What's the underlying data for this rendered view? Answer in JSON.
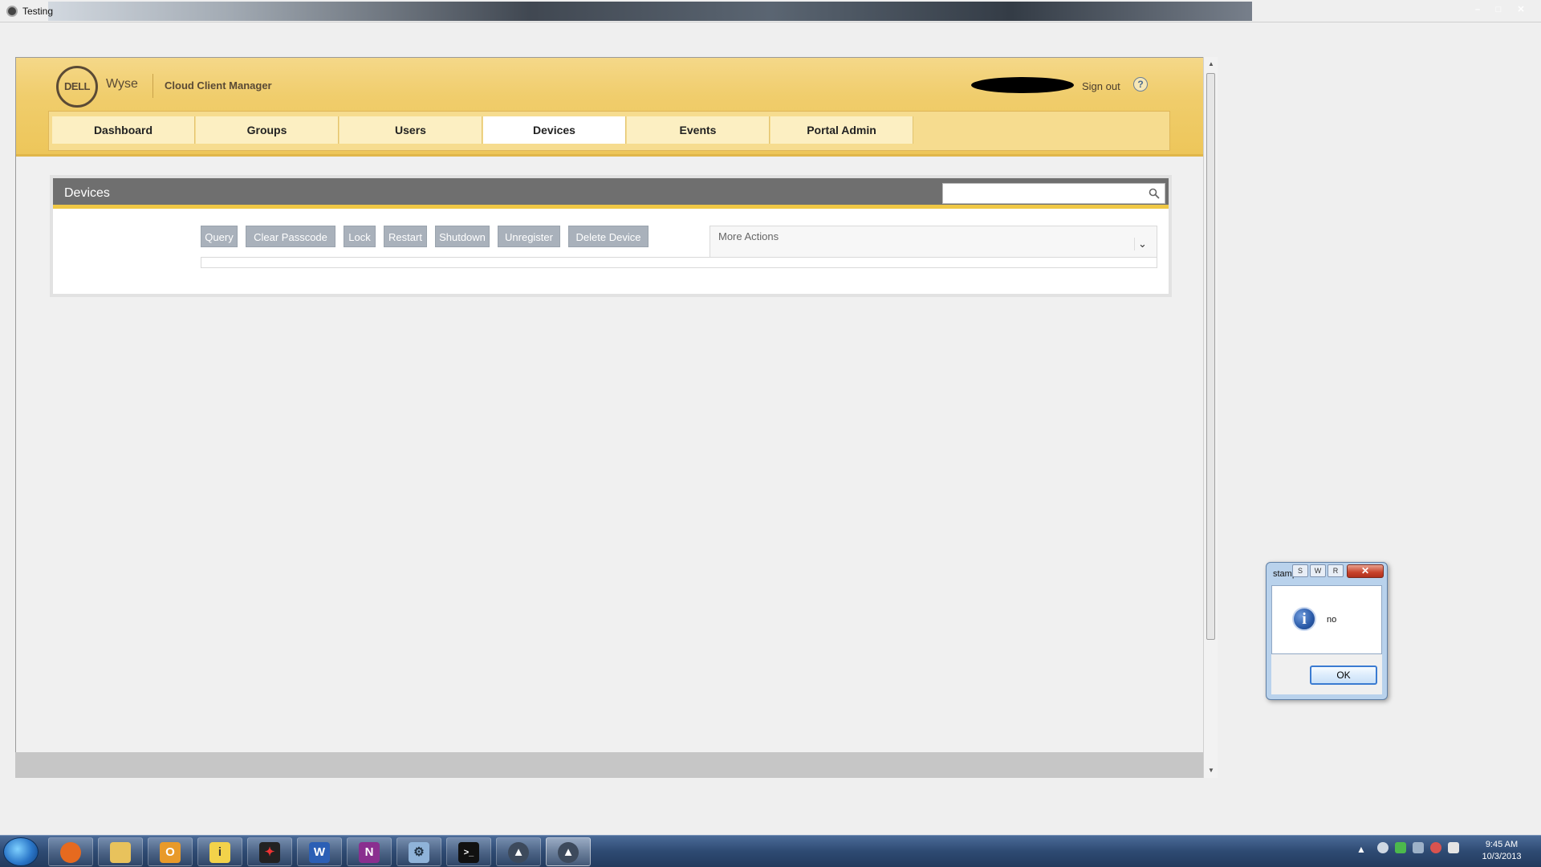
{
  "os_window": {
    "title": "Testing",
    "controls": [
      "–",
      "□",
      "✕"
    ]
  },
  "header": {
    "logo_text": "DELL",
    "brand": "Wyse",
    "product": "Cloud Client Manager",
    "signout_label": "Sign out",
    "help_label": "?"
  },
  "nav": {
    "tabs": [
      {
        "label": "Dashboard",
        "active": false
      },
      {
        "label": "Groups",
        "active": false
      },
      {
        "label": "Users",
        "active": false
      },
      {
        "label": "Devices",
        "active": true
      },
      {
        "label": "Events",
        "active": false
      },
      {
        "label": "Portal Admin",
        "active": false
      }
    ]
  },
  "devices_panel": {
    "title": "Devices",
    "search": {
      "value": "",
      "placeholder": ""
    },
    "actions": [
      "Query",
      "Clear Passcode",
      "Lock",
      "Restart",
      "Shutdown",
      "Unregister",
      "Delete Device"
    ],
    "more_actions_label": "More Actions"
  },
  "dialog": {
    "title": "stamp",
    "mini_buttons": [
      "S",
      "W",
      "R"
    ],
    "close_label": "✕",
    "message": "no",
    "ok_label": "OK"
  },
  "taskbar": {
    "apps": [
      {
        "icon": "firefox-icon",
        "glyph": "🦊"
      },
      {
        "icon": "folder-icon",
        "glyph": "📁"
      },
      {
        "icon": "outlook-icon",
        "glyph": "O"
      },
      {
        "icon": "app-icon",
        "glyph": "i"
      },
      {
        "icon": "puzzle-icon",
        "glyph": "✦"
      },
      {
        "icon": "word-icon",
        "glyph": "W"
      },
      {
        "icon": "onenote-icon",
        "glyph": "N"
      },
      {
        "icon": "network-icon",
        "glyph": "⚙"
      },
      {
        "icon": "terminal-icon",
        "glyph": ">_"
      },
      {
        "icon": "citrix-icon",
        "glyph": "▲"
      },
      {
        "icon": "citrix-active-icon",
        "glyph": "▲"
      }
    ],
    "time": "9:45 AM",
    "date": "10/3/2013"
  },
  "colors": {
    "header_gold": "#f0cd6c",
    "panel_gray": "#6f6f6f",
    "accent_yellow": "#f0c845",
    "action_button": "#a9b1bb",
    "taskbar_blue": "#2e4a72"
  }
}
